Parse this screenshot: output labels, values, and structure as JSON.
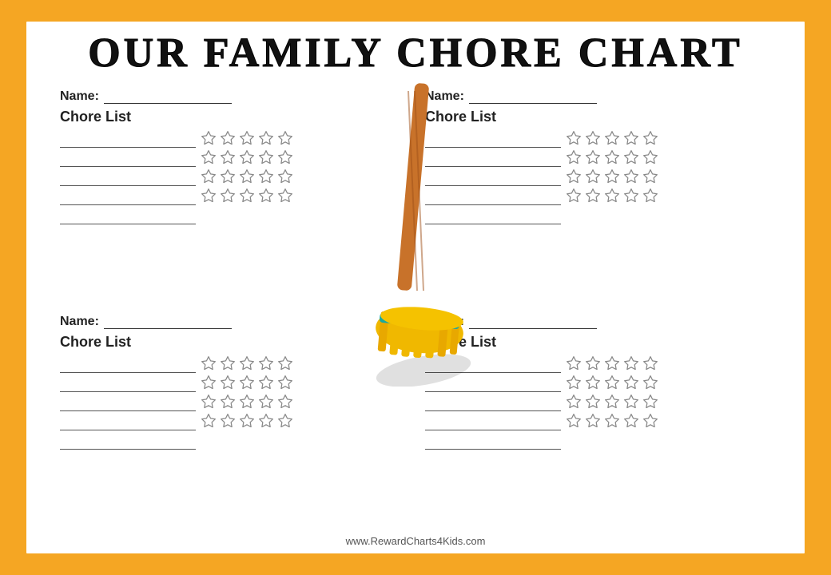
{
  "title": "OUR FAMILY CHORE CHART",
  "footer_url": "www.RewardCharts4Kids.com",
  "quadrants": [
    {
      "id": "top-left",
      "name_label": "Name:",
      "chore_label": "Chore List"
    },
    {
      "id": "top-right",
      "name_label": "Name:",
      "chore_label": "Chore List"
    },
    {
      "id": "bottom-left",
      "name_label": "Name:",
      "chore_label": "Chore List"
    },
    {
      "id": "bottom-right",
      "name_label": "Name:",
      "chore_label": "Chore List"
    }
  ],
  "chore_rows": 5,
  "star_cols": 5,
  "star_rows": 4
}
